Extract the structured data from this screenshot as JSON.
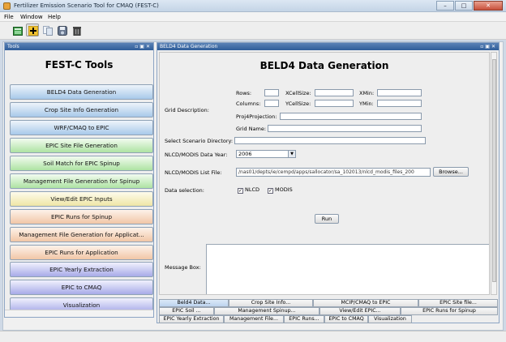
{
  "window": {
    "title": "Fertilizer Emission Scenario Tool for CMAQ (FEST-C)",
    "minimize": "–",
    "maximize": "□",
    "close": "✕"
  },
  "menu": [
    "File",
    "Window",
    "Help"
  ],
  "toolbar": {
    "icons": [
      "new-scenario-icon",
      "add-icon",
      "copy-icon",
      "save-icon",
      "delete-icon"
    ]
  },
  "tools_panel": {
    "title": "Tools",
    "heading": "FEST-C Tools",
    "items": [
      {
        "label": "BELD4 Data Generation",
        "color": "#a8c9ea"
      },
      {
        "label": "Crop Site Info Generation",
        "color": "#a8c9ea"
      },
      {
        "label": "WRF/CMAQ to EPIC",
        "color": "#a8c9ea"
      },
      {
        "label": "EPIC Site File Generation",
        "color": "#aee3a3"
      },
      {
        "label": "Soil Match for EPIC Spinup",
        "color": "#aee3a3"
      },
      {
        "label": "Management File Generation for Spinup",
        "color": "#aee3a3"
      },
      {
        "label": "View/Edit EPIC Inputs",
        "color": "#efe6a6"
      },
      {
        "label": "EPIC Runs for Spinup",
        "color": "#f1c6a6"
      },
      {
        "label": "Management File Generation for Applicat...",
        "color": "#f1c6a6"
      },
      {
        "label": "EPIC Runs for Application",
        "color": "#f1c6a6"
      },
      {
        "label": "EPIC Yearly Extraction",
        "color": "#a8abe8"
      },
      {
        "label": "EPIC to CMAQ",
        "color": "#a8abe8"
      },
      {
        "label": "Visualization",
        "color": "#a8abe8"
      }
    ]
  },
  "main_panel": {
    "title": "BELD4 Data Generation",
    "heading": "BELD4 Data Generation",
    "grid_description_label": "Grid Description:",
    "rows_label": "Rows:",
    "columns_label": "Columns:",
    "xcellsize_label": "XCellSize:",
    "ycellsize_label": "YCellSize:",
    "xmin_label": "XMin:",
    "ymin_label": "YMin:",
    "proj4_label": "Proj4Projection:",
    "gridname_label": "Grid Name:",
    "scenario_dir_label": "Select Scenario Directory:",
    "data_year_label": "NLCD/MODIS Data Year:",
    "data_year_value": "2006",
    "list_file_label": "NLCD/MODIS List File:",
    "list_file_value": "/nas01/depts/ie/cempd/apps/sallocator/sa_102013/nlcd_modis_files_200",
    "browse_label": "Browse...",
    "data_selection_label": "Data selection:",
    "nlcd_label": "NLCD",
    "modis_label": "MODIS",
    "run_label": "Run",
    "message_box_label": "Message Box:"
  },
  "tabs": {
    "row1": [
      "Beld4 Data...",
      "Crop Site Info...",
      "MCIP/CMAQ to EPIC",
      "EPIC Site file..."
    ],
    "row2": [
      "EPIC Soil ...",
      "Management Spinup...",
      "View/Edit EPIC...",
      "EPIC Runs for Spinup"
    ],
    "row3": [
      "EPIC Yearly Extraction",
      "Management File...",
      "EPIC Runs...",
      "EPIC to CMAQ",
      "Visualization"
    ]
  }
}
